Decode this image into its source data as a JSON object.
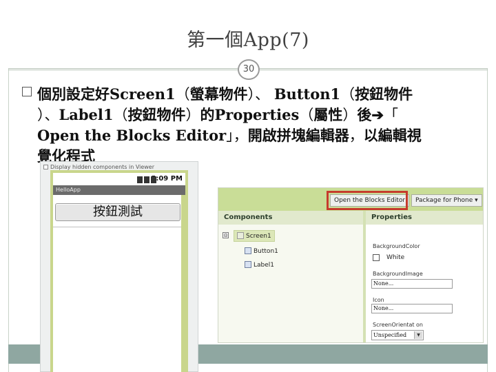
{
  "slide": {
    "title": "第一個App(7)",
    "page_number": "30"
  },
  "bullet": {
    "lines": [
      {
        "b1": "個別設定好Screen1",
        "n1": "（",
        "b2": "螢幕物件",
        "n2": "）、 ",
        "b3": "Button1",
        "n3": "（",
        "b4": "按鈕物件"
      },
      {
        "n1": "）、",
        "b2": "Label1",
        "n2": "（",
        "b3": "按鈕物件",
        "n3": "）",
        "b4": "的Properties",
        "n4": "（",
        "b5": "屬性",
        "n5": "）",
        "b6": "後",
        "arrow": "➔",
        "n6": "「"
      },
      {
        "b1": "Open the Blocks Editor",
        "n1": "」，",
        "b2": "開啟拼塊編輯器",
        "n2": "，",
        "b3": "以編輯視"
      },
      {
        "b1": "覺化程式"
      }
    ]
  },
  "phone": {
    "checkbox_label": "Display hidden components in Viewer",
    "status_time": "5:09 PM",
    "app_title": "HelloApp",
    "button_text": "按鈕測試"
  },
  "designer": {
    "toolbar": {
      "blocks_editor_label": "Open the Blocks Editor",
      "package_label": "Package for Phone ▾"
    },
    "components_header": "Components",
    "properties_header": "Properties",
    "tree": {
      "toggle": "⊟",
      "screen": "Screen1",
      "button": "Button1",
      "label": "Label1"
    },
    "properties": {
      "background_color_label": "BackgroundColor",
      "background_color_value": "White",
      "background_image_label": "BackgroundImage",
      "background_image_value": "None...",
      "icon_label": "Icon",
      "icon_value": "None...",
      "orientation_label": "ScreenOrientat on",
      "orientation_value": "Unspecified",
      "dropdown_arrow": "▼"
    },
    "highlight_color": "#c63b2c",
    "toolbar_color": "#c9dd97"
  },
  "colors": {
    "bottom_band": "#8fa7a1",
    "phone_bezel": "#c9d68c"
  }
}
